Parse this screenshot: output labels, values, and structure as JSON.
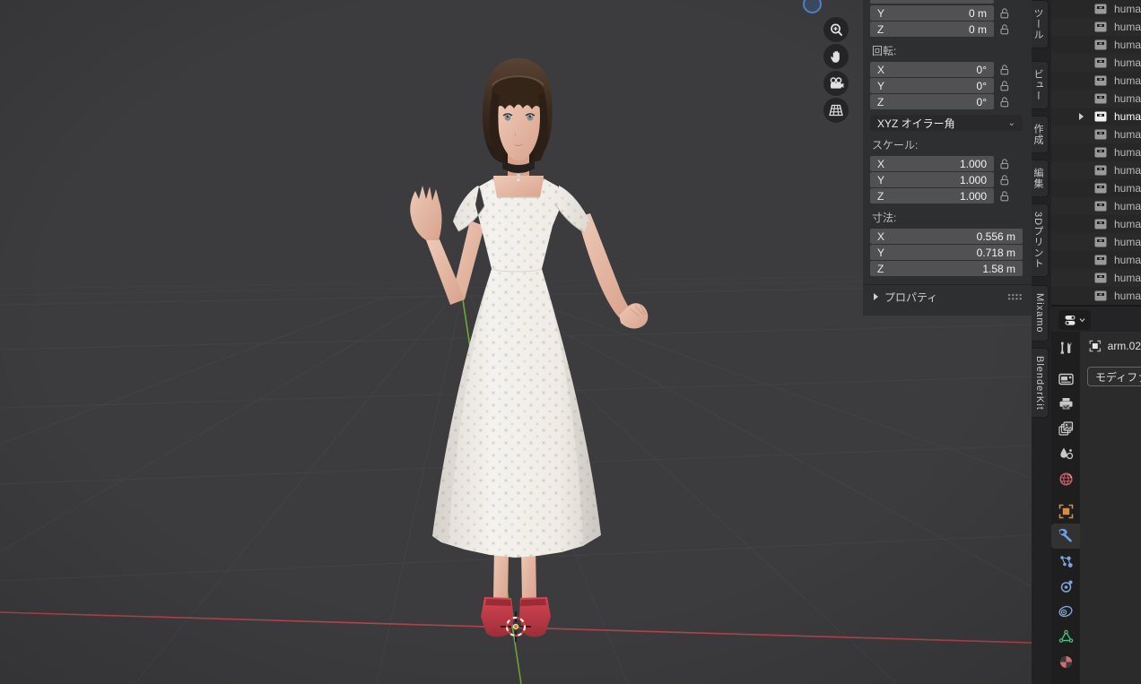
{
  "viewport": {
    "gizmos": [
      {
        "name": "zoom",
        "icon": "magnifier-icon"
      },
      {
        "name": "pan",
        "icon": "hand-icon"
      },
      {
        "name": "camera-view",
        "icon": "camera-icon"
      },
      {
        "name": "toggle-grid",
        "icon": "grid-icon"
      }
    ],
    "axis_colors": {
      "x": "#c8454f",
      "y": "#74b33d"
    },
    "cursor_color": "#e8860c",
    "model_colors": {
      "dress": "#f1eeea",
      "hair": "#3a2b21",
      "skin": "#e9c4b0",
      "shoes": "#c23a48"
    }
  },
  "transform_panel": {
    "location_rows": [
      {
        "axis": "Y",
        "value": "0 m"
      },
      {
        "axis": "Z",
        "value": "0 m"
      }
    ],
    "rotation_label": "回転:",
    "rotation_rows": [
      {
        "axis": "X",
        "value": "0°"
      },
      {
        "axis": "Y",
        "value": "0°"
      },
      {
        "axis": "Z",
        "value": "0°"
      }
    ],
    "rotation_mode": "XYZ オイラー角",
    "scale_label": "スケール:",
    "scale_rows": [
      {
        "axis": "X",
        "value": "1.000"
      },
      {
        "axis": "Y",
        "value": "1.000"
      },
      {
        "axis": "Z",
        "value": "1.000"
      }
    ],
    "dimensions_label": "寸法:",
    "dimension_rows": [
      {
        "axis": "X",
        "value": "0.556 m"
      },
      {
        "axis": "Y",
        "value": "0.718 m"
      },
      {
        "axis": "Z",
        "value": "1.58 m"
      }
    ],
    "properties_section_label": "プロパティ"
  },
  "sidebar_tabs": [
    {
      "label": "ツール"
    },
    {
      "label": "ビュー"
    },
    {
      "label": "作成"
    },
    {
      "label": "編集"
    },
    {
      "label": "3Dプリント"
    },
    {
      "label": "Mixamo"
    },
    {
      "label": "BlenderKit"
    }
  ],
  "outliner": {
    "items": [
      {
        "label": "human",
        "selected": false
      },
      {
        "label": "human",
        "selected": false
      },
      {
        "label": "human",
        "selected": false
      },
      {
        "label": "human",
        "selected": false
      },
      {
        "label": "human",
        "selected": false
      },
      {
        "label": "human",
        "selected": false
      },
      {
        "label": "human",
        "selected": true
      },
      {
        "label": "human",
        "selected": false
      },
      {
        "label": "human",
        "selected": false
      },
      {
        "label": "human",
        "selected": false
      },
      {
        "label": "human",
        "selected": false
      },
      {
        "label": "human",
        "selected": false
      },
      {
        "label": "human",
        "selected": false
      },
      {
        "label": "human",
        "selected": false
      },
      {
        "label": "human",
        "selected": false
      },
      {
        "label": "human",
        "selected": false
      },
      {
        "label": "human",
        "selected": false
      }
    ]
  },
  "properties_editor": {
    "active_object": "arm.02",
    "modifier_button_label": "モディファ",
    "active_tab": "modifiers",
    "tabs": [
      "tool",
      "render",
      "output",
      "view-layer",
      "scene",
      "world",
      "object",
      "modifiers",
      "particles",
      "physics",
      "constraints",
      "object-data",
      "material"
    ]
  }
}
